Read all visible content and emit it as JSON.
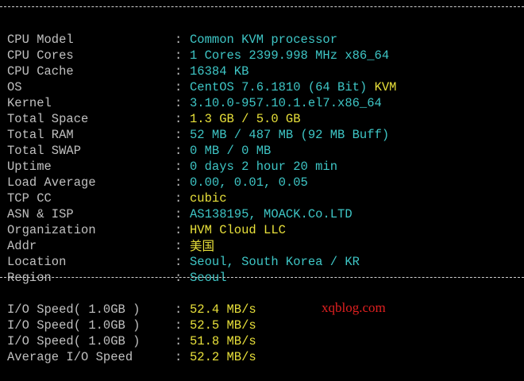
{
  "colors": {
    "background": "#000000",
    "label": "#c0c0c0",
    "info_value": "#3ec6c6",
    "highlight_value": "#e8e03a",
    "watermark": "#e02020"
  },
  "separator": ":",
  "system_info": [
    {
      "label": "CPU Model",
      "value": "Common KVM processor"
    },
    {
      "label": "CPU Cores",
      "value": "1 Cores 2399.998 MHz x86_64"
    },
    {
      "label": "CPU Cache",
      "value": "16384 KB"
    },
    {
      "label": "OS",
      "value": "CentOS 7.6.1810 (64 Bit)",
      "extra": "KVM"
    },
    {
      "label": "Kernel",
      "value": "3.10.0-957.10.1.el7.x86_64"
    },
    {
      "label": "Total Space",
      "value": "1.3 GB / 5.0 GB"
    },
    {
      "label": "Total RAM",
      "value": "52 MB / 487 MB (92 MB Buff)"
    },
    {
      "label": "Total SWAP",
      "value": "0 MB / 0 MB"
    },
    {
      "label": "Uptime",
      "value": "0 days 2 hour 20 min"
    },
    {
      "label": "Load Average",
      "value": "0.00, 0.01, 0.05"
    },
    {
      "label": "TCP CC",
      "value": "cubic"
    },
    {
      "label": "ASN & ISP",
      "value": "AS138195, MOACK.Co.LTD"
    },
    {
      "label": "Organization",
      "value": "HVM Cloud LLC"
    },
    {
      "label": "Addr",
      "value": "美国"
    },
    {
      "label": "Location",
      "value": "Seoul, South Korea / KR"
    },
    {
      "label": "Region",
      "value": "Seoul"
    }
  ],
  "io_speed": [
    {
      "label": "I/O Speed( 1.0GB )",
      "value": "52.4 MB/s"
    },
    {
      "label": "I/O Speed( 1.0GB )",
      "value": "52.5 MB/s"
    },
    {
      "label": "I/O Speed( 1.0GB )",
      "value": "51.8 MB/s"
    },
    {
      "label": "Average I/O Speed",
      "value": "52.2 MB/s"
    }
  ],
  "watermark": "xqblog.com"
}
